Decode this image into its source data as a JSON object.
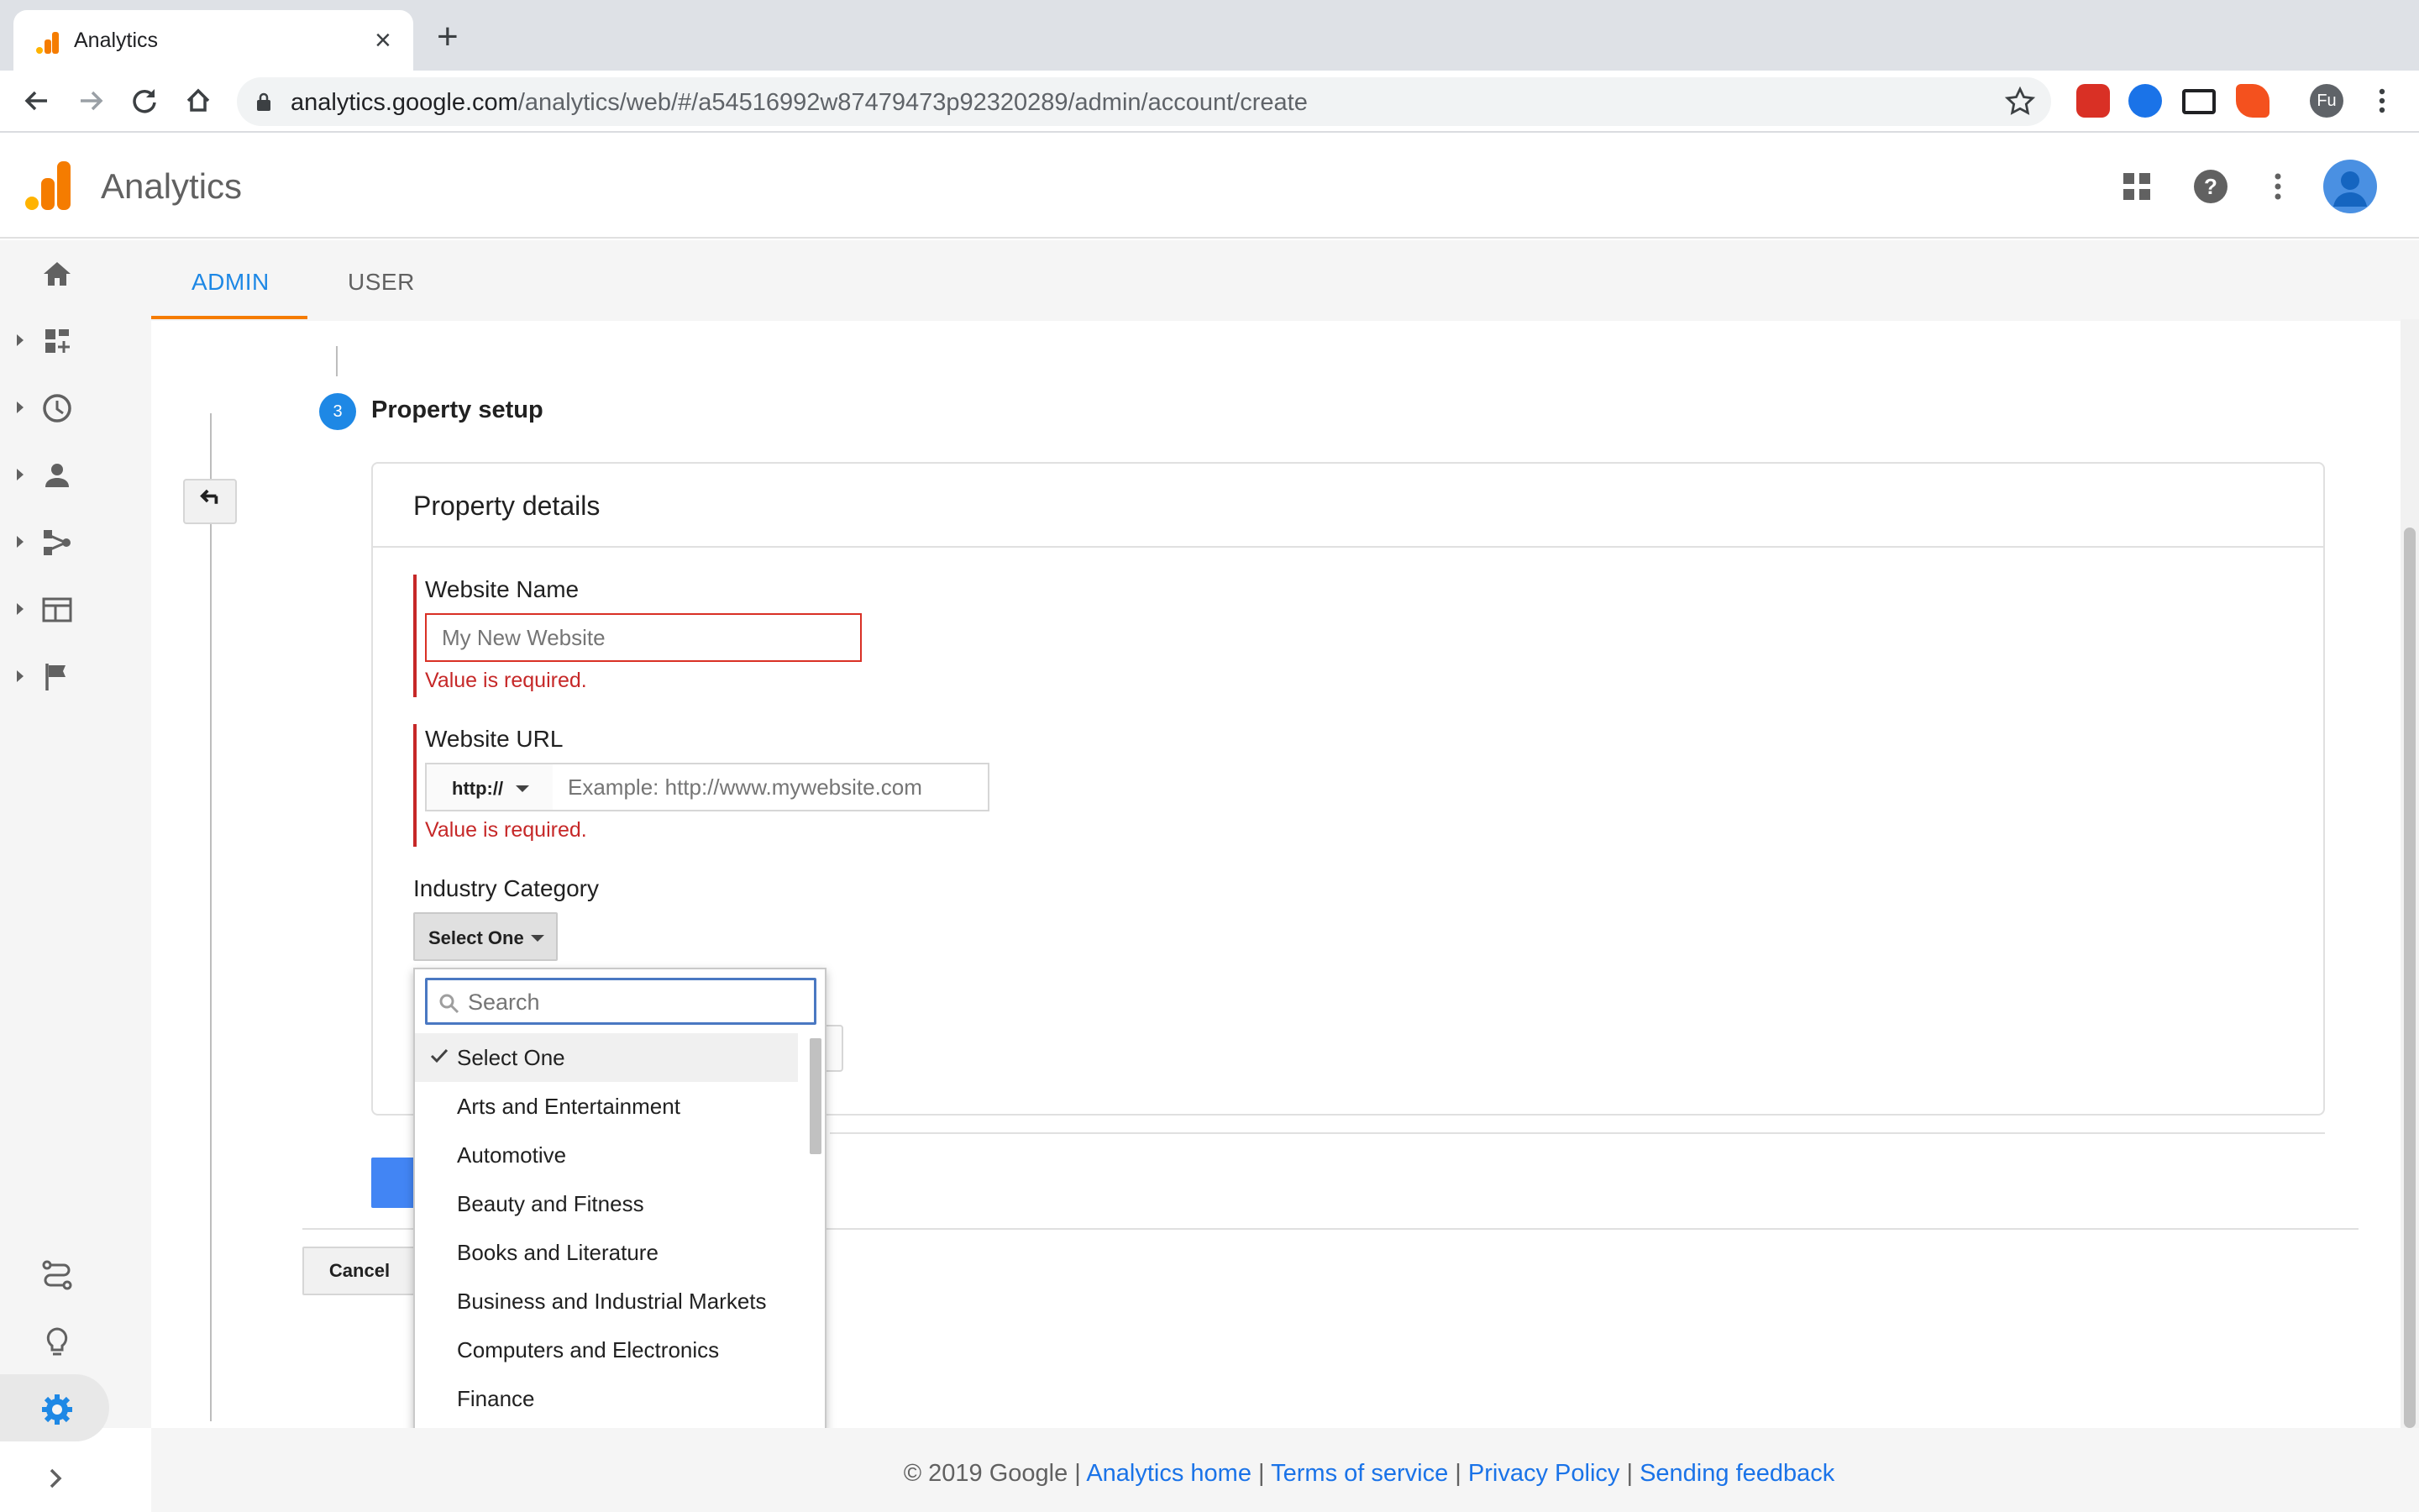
{
  "browser": {
    "tab_title": "Analytics",
    "url_domain": "analytics.google.com",
    "url_path": "/analytics/web/#/a54516992w87479473p92320289/admin/account/create",
    "profile_initials": "Fu"
  },
  "app": {
    "title": "Analytics"
  },
  "tabs": {
    "admin": "ADMIN",
    "user": "USER"
  },
  "step": {
    "number": "3",
    "title": "Property setup"
  },
  "card": {
    "title": "Property details"
  },
  "form": {
    "website_name": {
      "label": "Website Name",
      "placeholder": "My New Website",
      "error": "Value is required."
    },
    "website_url": {
      "label": "Website URL",
      "protocol": "http://",
      "placeholder": "Example: http://www.mywebsite.com",
      "error": "Value is required."
    },
    "industry": {
      "label": "Industry Category",
      "selected": "Select One"
    }
  },
  "dropdown": {
    "search_placeholder": "Search",
    "options": [
      "Select One",
      "Arts and Entertainment",
      "Automotive",
      "Beauty and Fitness",
      "Books and Literature",
      "Business and Industrial Markets",
      "Computers and Electronics",
      "Finance"
    ]
  },
  "buttons": {
    "cancel": "Cancel"
  },
  "footer": {
    "copyright": "© 2019 Google |",
    "sep": "|",
    "links": [
      "Analytics home",
      "Terms of service",
      "Privacy Policy",
      "Sending feedback"
    ]
  },
  "colors": {
    "accent_blue": "#1e88e5",
    "error_red": "#c62828",
    "tab_underline": "#f57c00",
    "logo_orange": "#f57c00",
    "logo_yellow": "#ffb300"
  },
  "icons": {
    "nav": [
      "home-icon",
      "dashboard-icon",
      "clock-icon",
      "person-icon",
      "acquisition-icon",
      "behavior-icon",
      "flag-icon",
      "route-icon",
      "lightbulb-icon",
      "gear-icon"
    ],
    "header": [
      "apps-grid-icon",
      "help-icon",
      "more-vert-icon",
      "account-icon"
    ]
  }
}
